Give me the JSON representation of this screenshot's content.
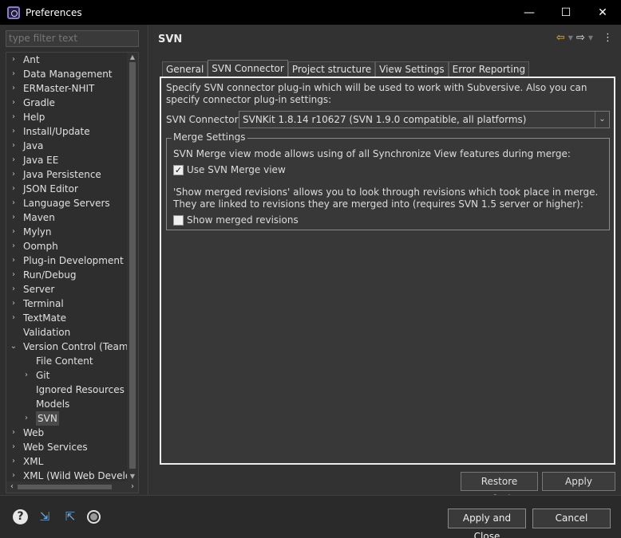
{
  "window": {
    "title": "Preferences",
    "controls": [
      "—",
      "☐",
      "✕"
    ]
  },
  "sidebar": {
    "filter_placeholder": "type filter text",
    "items": [
      {
        "label": "Ant",
        "level": 0,
        "arrow": ">"
      },
      {
        "label": "Data Management",
        "level": 0,
        "arrow": ">"
      },
      {
        "label": "ERMaster-NHIT",
        "level": 0,
        "arrow": ">"
      },
      {
        "label": "Gradle",
        "level": 0,
        "arrow": ">"
      },
      {
        "label": "Help",
        "level": 0,
        "arrow": ">"
      },
      {
        "label": "Install/Update",
        "level": 0,
        "arrow": ">"
      },
      {
        "label": "Java",
        "level": 0,
        "arrow": ">"
      },
      {
        "label": "Java EE",
        "level": 0,
        "arrow": ">"
      },
      {
        "label": "Java Persistence",
        "level": 0,
        "arrow": ">"
      },
      {
        "label": "JSON Editor",
        "level": 0,
        "arrow": ">"
      },
      {
        "label": "Language Servers",
        "level": 0,
        "arrow": ">"
      },
      {
        "label": "Maven",
        "level": 0,
        "arrow": ">"
      },
      {
        "label": "Mylyn",
        "level": 0,
        "arrow": ">"
      },
      {
        "label": "Oomph",
        "level": 0,
        "arrow": ">"
      },
      {
        "label": "Plug-in Development",
        "level": 0,
        "arrow": ">"
      },
      {
        "label": "Run/Debug",
        "level": 0,
        "arrow": ">"
      },
      {
        "label": "Server",
        "level": 0,
        "arrow": ">"
      },
      {
        "label": "Terminal",
        "level": 0,
        "arrow": ">"
      },
      {
        "label": "TextMate",
        "level": 0,
        "arrow": ">"
      },
      {
        "label": "Validation",
        "level": 0,
        "arrow": ""
      },
      {
        "label": "Version Control (Team)",
        "level": 0,
        "arrow": "v"
      },
      {
        "label": "File Content",
        "level": 1,
        "arrow": ""
      },
      {
        "label": "Git",
        "level": 1,
        "arrow": ">"
      },
      {
        "label": "Ignored Resources",
        "level": 1,
        "arrow": ""
      },
      {
        "label": "Models",
        "level": 1,
        "arrow": ""
      },
      {
        "label": "SVN",
        "level": 1,
        "arrow": ">",
        "selected": true
      },
      {
        "label": "Web",
        "level": 0,
        "arrow": ">"
      },
      {
        "label": "Web Services",
        "level": 0,
        "arrow": ">"
      },
      {
        "label": "XML",
        "level": 0,
        "arrow": ">"
      },
      {
        "label": "XML (Wild Web Developer)",
        "level": 0,
        "arrow": ">"
      }
    ]
  },
  "page": {
    "title": "SVN",
    "tabs": [
      "General",
      "SVN Connector",
      "Project structure",
      "View Settings",
      "Error Reporting"
    ],
    "active_tab": "SVN Connector",
    "description": "Specify SVN connector plug-in which will be used to work with Subversive. Also you can specify connector plug-in settings:",
    "connector_label": "SVN Connector:",
    "connector_value": "SVNKit 1.8.14 r10627 (SVN 1.9.0 compatible, all platforms)",
    "merge_group": {
      "title": "Merge Settings",
      "text1": "SVN Merge view mode allows using of all Synchronize View features during merge:",
      "checkbox1_label": "Use SVN Merge view",
      "checkbox1_checked": true,
      "text2": "'Show merged revisions' allows you to look through revisions which took place in merge. They are linked to revisions they are merged into (requires SVN 1.5 server or higher):",
      "checkbox2_label": "Show merged revisions",
      "checkbox2_checked": false
    },
    "restore_defaults_label": "Restore Defaults",
    "apply_label": "Apply"
  },
  "footer": {
    "apply_close_label": "Apply and Close",
    "cancel_label": "Cancel",
    "icons": [
      "help-icon",
      "import-icon",
      "export-icon",
      "record-icon"
    ]
  }
}
